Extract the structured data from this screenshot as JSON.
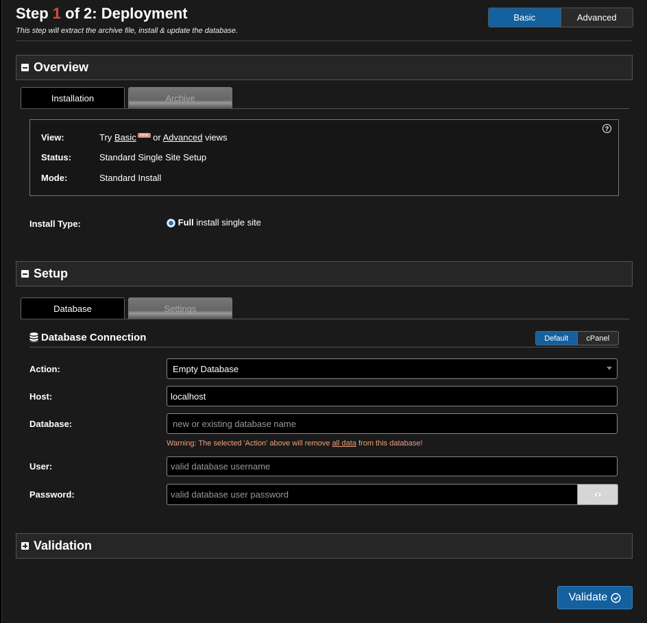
{
  "header": {
    "title_prefix": "Step ",
    "title_step": "1",
    "title_suffix": " of 2: Deployment",
    "subtitle": "This step will extract the archive file, install & update the database.",
    "view_toggle": {
      "basic": "Basic",
      "advanced": "Advanced"
    }
  },
  "overview": {
    "title": "Overview",
    "tabs": {
      "installation": "Installation",
      "archive": "Archive"
    },
    "info": {
      "view_label": "View:",
      "view_try": "Try ",
      "view_basic": "Basic",
      "view_new": "new",
      "view_or": " or ",
      "view_advanced": "Advanced",
      "view_views": " views",
      "status_label": "Status:",
      "status_value": "Standard Single Site Setup",
      "mode_label": "Mode:",
      "mode_value": "Standard Install",
      "help": "?"
    },
    "install_type": {
      "label": "Install Type:",
      "option_bold": "Full",
      "option_rest": " install single site"
    }
  },
  "setup": {
    "title": "Setup",
    "tabs": {
      "database": "Database",
      "settings": "Settings"
    },
    "db_connection": {
      "title": "Database Connection",
      "toggle": {
        "default": "Default",
        "cpanel": "cPanel"
      },
      "action_label": "Action:",
      "action_value": "Empty Database",
      "host_label": "Host:",
      "host_value": "localhost",
      "database_label": "Database:",
      "database_placeholder": "new or existing database name",
      "warning_pre": "Warning: The selected 'Action' above will remove ",
      "warning_link": "all data",
      "warning_post": " from this database!",
      "user_label": "User:",
      "user_placeholder": "valid database username",
      "password_label": "Password:",
      "password_placeholder": "valid database user password"
    }
  },
  "validation": {
    "title": "Validation"
  },
  "footer": {
    "validate_label": "Validate"
  }
}
